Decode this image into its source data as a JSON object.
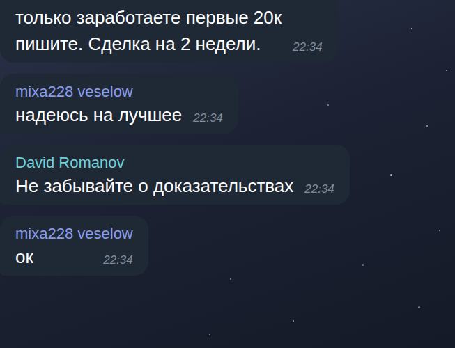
{
  "messages": [
    {
      "text": "только заработаете первые 20к\nпишите. Сделка на 2 недели.",
      "time": "22:34"
    },
    {
      "sender": "mixa228 veselow",
      "color": "#8a9cf0",
      "text": "надеюсь на лучшее",
      "time": "22:34"
    },
    {
      "sender": "David Romanov",
      "color": "#6fd3dc",
      "text": "Не забывайте о доказательствах",
      "time": "22:34"
    },
    {
      "sender": "mixa228 veselow",
      "color": "#8a9cf0",
      "text": "ок",
      "time": "22:34"
    }
  ]
}
